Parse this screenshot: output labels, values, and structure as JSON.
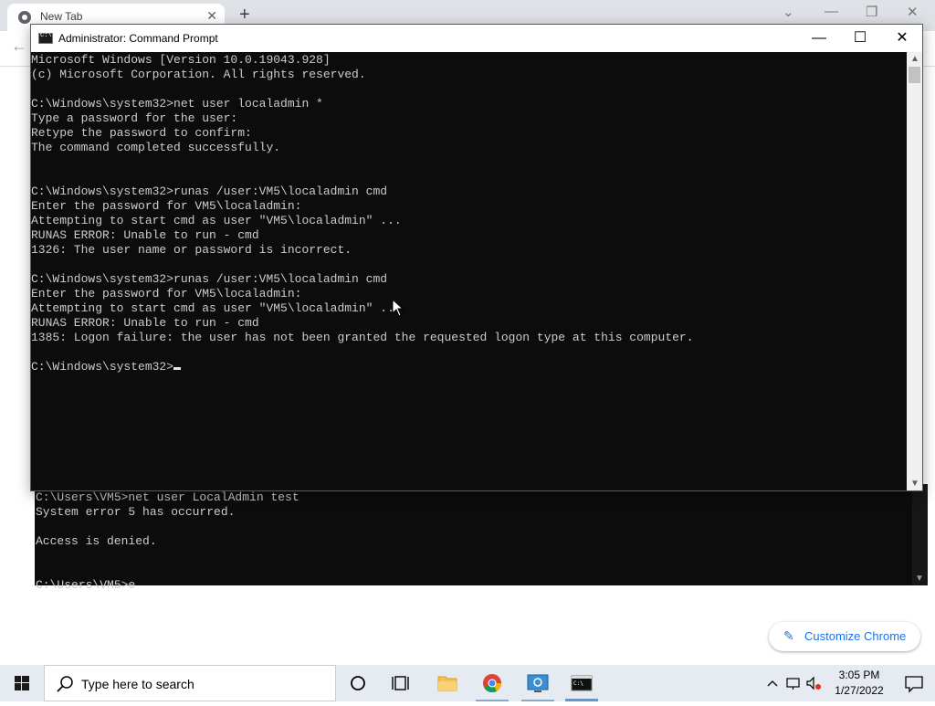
{
  "chrome": {
    "tab_title": "New Tab",
    "tab_close": "✕",
    "new_tab": "+",
    "back": "←",
    "caption_dropdown": "⌄",
    "caption_min": "—",
    "caption_max": "❐",
    "caption_close": "✕",
    "customize_label": "Customize Chrome",
    "customize_icon": "✎"
  },
  "background_console": {
    "lines": "C:\\Users\\VM5>net user LocalAdmin test\nSystem error 5 has occurred.\n\nAccess is denied.\n\n\nC:\\Users\\VM5>e"
  },
  "cmd": {
    "title": "Administrator: Command Prompt",
    "minimize": "—",
    "maximize": "☐",
    "close": "✕",
    "output": "Microsoft Windows [Version 10.0.19043.928]\n(c) Microsoft Corporation. All rights reserved.\n\nC:\\Windows\\system32>net user localadmin *\nType a password for the user:\nRetype the password to confirm:\nThe command completed successfully.\n\n\nC:\\Windows\\system32>runas /user:VM5\\localadmin cmd\nEnter the password for VM5\\localadmin:\nAttempting to start cmd as user \"VM5\\localadmin\" ...\nRUNAS ERROR: Unable to run - cmd\n1326: The user name or password is incorrect.\n\nC:\\Windows\\system32>runas /user:VM5\\localadmin cmd\nEnter the password for VM5\\localadmin:\nAttempting to start cmd as user \"VM5\\localadmin\" ...\nRUNAS ERROR: Unable to run - cmd\n1385: Logon failure: the user has not been granted the requested logon type at this computer.\n\n",
    "prompt": "C:\\Windows\\system32>"
  },
  "taskbar": {
    "search_placeholder": "Type here to search",
    "time": "3:05 PM",
    "date": "1/27/2022",
    "apps": [
      "cortana-icon",
      "task-view-icon",
      "file-explorer-icon",
      "chrome-icon",
      "search-app-icon",
      "cmd-icon"
    ]
  }
}
